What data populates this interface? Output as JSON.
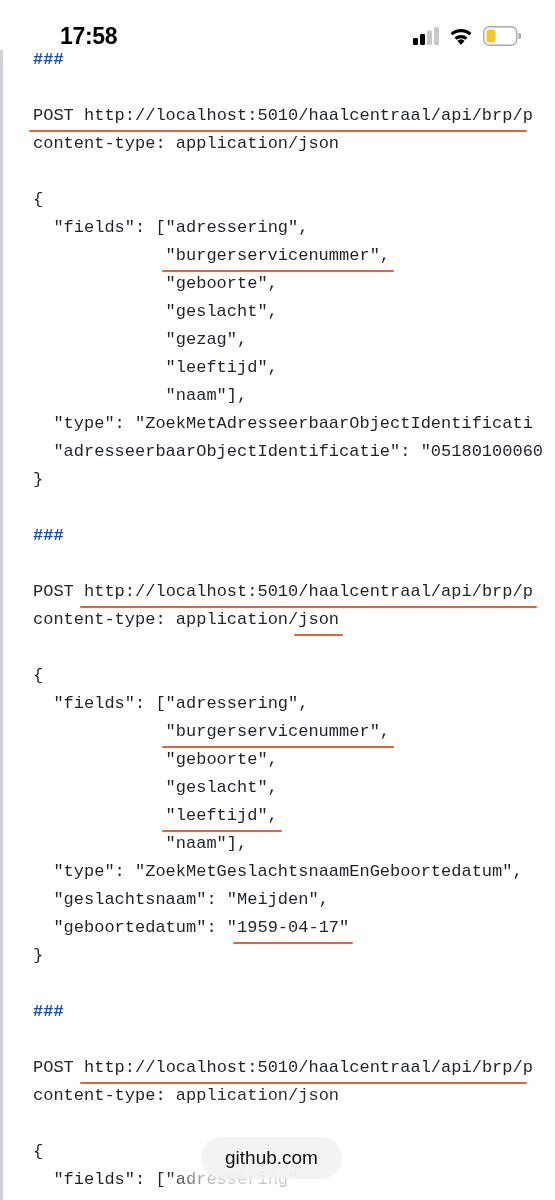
{
  "status_bar": {
    "time": "17:58"
  },
  "code_lines": [
    {
      "kind": "separator",
      "text": "###"
    },
    {
      "kind": "blank"
    },
    {
      "kind": "code",
      "segments": [
        {
          "text": "POST http://localhost:5010/haalcentraal/api/brp/",
          "underlined": true
        },
        {
          "text": "p"
        }
      ]
    },
    {
      "kind": "code",
      "text": "content-type: application/json"
    },
    {
      "kind": "blank"
    },
    {
      "kind": "code",
      "text": "{"
    },
    {
      "kind": "code",
      "text": "  \"fields\": [\"adressering\","
    },
    {
      "kind": "code",
      "segments": [
        {
          "text": "             \"burgerservicenummer\",",
          "underlined": true
        }
      ]
    },
    {
      "kind": "code",
      "text": "             \"geboorte\","
    },
    {
      "kind": "code",
      "text": "             \"geslacht\","
    },
    {
      "kind": "code",
      "text": "             \"gezag\","
    },
    {
      "kind": "code",
      "text": "             \"leeftijd\","
    },
    {
      "kind": "code",
      "text": "             \"naam\"],"
    },
    {
      "kind": "code",
      "text": "  \"type\": \"ZoekMetAdresseerbaarObjectIdentificati"
    },
    {
      "kind": "code",
      "text": "  \"adresseerbaarObjectIdentificatie\": \"05180100060"
    },
    {
      "kind": "code",
      "text": "}"
    },
    {
      "kind": "blank"
    },
    {
      "kind": "separator",
      "text": "###"
    },
    {
      "kind": "blank"
    },
    {
      "kind": "code",
      "segments": [
        {
          "text": "POST "
        },
        {
          "text": "http://localhost:5010/haalcentraal/api/brp/p",
          "underlined": true
        }
      ]
    },
    {
      "kind": "code",
      "segments": [
        {
          "text": "content-type: application/"
        },
        {
          "text": "json",
          "underlined": true
        }
      ]
    },
    {
      "kind": "blank"
    },
    {
      "kind": "code",
      "text": "{"
    },
    {
      "kind": "code",
      "text": "  \"fields\": [\"adressering\","
    },
    {
      "kind": "code",
      "segments": [
        {
          "text": "             \"burgerservicenummer\",",
          "underlined": true
        }
      ]
    },
    {
      "kind": "code",
      "text": "             \"geboorte\","
    },
    {
      "kind": "code",
      "text": "             \"geslacht\","
    },
    {
      "kind": "code",
      "segments": [
        {
          "text": "             \"leeftijd\",",
          "underlined": true
        }
      ]
    },
    {
      "kind": "code",
      "text": "             \"naam\"],"
    },
    {
      "kind": "code",
      "text": "  \"type\": \"ZoekMetGeslachtsnaamEnGeboortedatum\","
    },
    {
      "kind": "code",
      "text": "  \"geslachtsnaam\": \"Meijden\","
    },
    {
      "kind": "code",
      "segments": [
        {
          "text": "  \"geboortedatum\": \""
        },
        {
          "text": "1959-04-17\"",
          "underlined": true
        }
      ]
    },
    {
      "kind": "code",
      "text": "}"
    },
    {
      "kind": "blank"
    },
    {
      "kind": "separator",
      "text": "###"
    },
    {
      "kind": "blank"
    },
    {
      "kind": "code",
      "segments": [
        {
          "text": "POST "
        },
        {
          "text": "http://localhost:5010/haalcentraal/api/brp/",
          "underlined": true
        },
        {
          "text": "p"
        }
      ]
    },
    {
      "kind": "code",
      "text": "content-type: application/json"
    },
    {
      "kind": "blank"
    },
    {
      "kind": "code",
      "text": "{"
    },
    {
      "kind": "code",
      "text": "  \"fields\": [\"adressering\""
    }
  ],
  "address_pill": {
    "text": "github.com"
  }
}
